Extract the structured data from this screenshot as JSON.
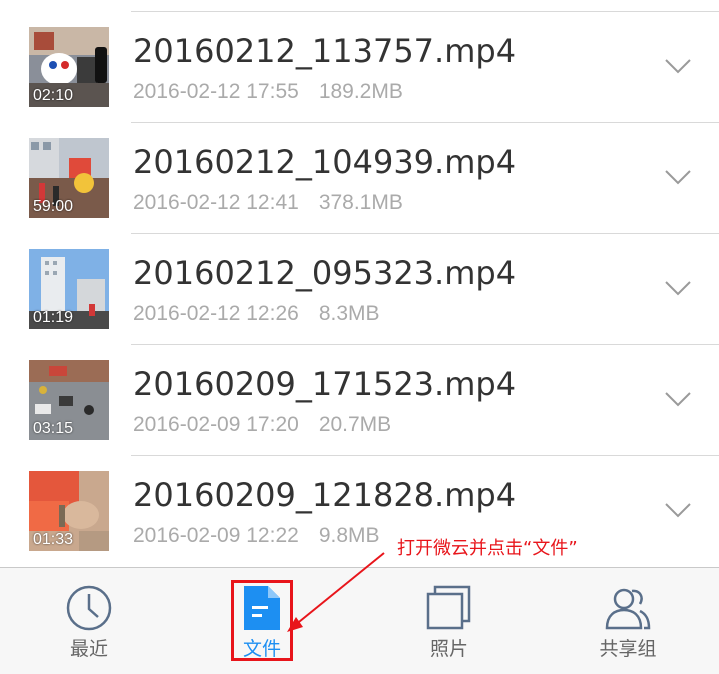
{
  "files": [
    {
      "name": "20160212_113757.mp4",
      "date": "2016-02-12 17:55",
      "size": "189.2MB",
      "duration": "02:10",
      "thumb_icon": "lion-dance-video-thumbnail"
    },
    {
      "name": "20160212_104939.mp4",
      "date": "2016-02-12 12:41",
      "size": "378.1MB",
      "duration": "59:00",
      "thumb_icon": "street-festival-video-thumbnail"
    },
    {
      "name": "20160212_095323.mp4",
      "date": "2016-02-12 12:26",
      "size": "8.3MB",
      "duration": "01:19",
      "thumb_icon": "city-buildings-video-thumbnail"
    },
    {
      "name": "20160209_171523.mp4",
      "date": "2016-02-09 17:20",
      "size": "20.7MB",
      "duration": "03:15",
      "thumb_icon": "street-aerial-video-thumbnail"
    },
    {
      "name": "20160209_121828.mp4",
      "date": "2016-02-09 12:22",
      "size": "9.8MB",
      "duration": "01:33",
      "thumb_icon": "hand-closeup-video-thumbnail"
    }
  ],
  "tabbar": {
    "tabs": [
      {
        "label": "最近",
        "icon": "clock-icon",
        "active": false
      },
      {
        "label": "文件",
        "icon": "document-icon",
        "active": true
      },
      {
        "label": "照片",
        "icon": "photos-icon",
        "active": false
      },
      {
        "label": "共享组",
        "icon": "group-icon",
        "active": false
      }
    ]
  },
  "annotation": {
    "text": "打开微云并点击“文件”"
  },
  "colors": {
    "accent": "#1d8ff2",
    "annotation_red": "#e8151b",
    "filename": "#333333",
    "meta": "#aaaaaa"
  }
}
